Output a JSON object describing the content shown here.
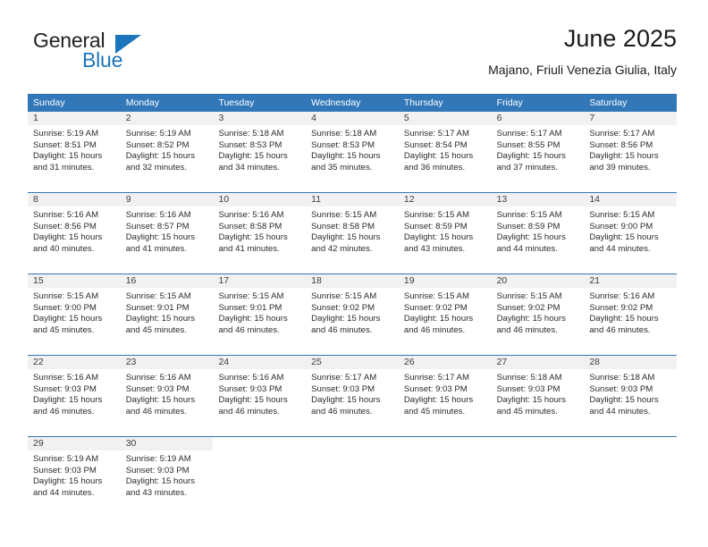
{
  "brand": {
    "name_part1": "General",
    "name_part2": "Blue",
    "accent_color": "#1b75bc"
  },
  "header": {
    "title": "June 2025",
    "location": "Majano, Friuli Venezia Giulia, Italy"
  },
  "theme": {
    "header_blue": "#3277b8",
    "daynum_band": "#f1f1f1"
  },
  "weekdays": [
    "Sunday",
    "Monday",
    "Tuesday",
    "Wednesday",
    "Thursday",
    "Friday",
    "Saturday"
  ],
  "weeks": [
    [
      {
        "day": "1",
        "sunrise": "Sunrise: 5:19 AM",
        "sunset": "Sunset: 8:51 PM",
        "daylight1": "Daylight: 15 hours",
        "daylight2": "and 31 minutes."
      },
      {
        "day": "2",
        "sunrise": "Sunrise: 5:19 AM",
        "sunset": "Sunset: 8:52 PM",
        "daylight1": "Daylight: 15 hours",
        "daylight2": "and 32 minutes."
      },
      {
        "day": "3",
        "sunrise": "Sunrise: 5:18 AM",
        "sunset": "Sunset: 8:53 PM",
        "daylight1": "Daylight: 15 hours",
        "daylight2": "and 34 minutes."
      },
      {
        "day": "4",
        "sunrise": "Sunrise: 5:18 AM",
        "sunset": "Sunset: 8:53 PM",
        "daylight1": "Daylight: 15 hours",
        "daylight2": "and 35 minutes."
      },
      {
        "day": "5",
        "sunrise": "Sunrise: 5:17 AM",
        "sunset": "Sunset: 8:54 PM",
        "daylight1": "Daylight: 15 hours",
        "daylight2": "and 36 minutes."
      },
      {
        "day": "6",
        "sunrise": "Sunrise: 5:17 AM",
        "sunset": "Sunset: 8:55 PM",
        "daylight1": "Daylight: 15 hours",
        "daylight2": "and 37 minutes."
      },
      {
        "day": "7",
        "sunrise": "Sunrise: 5:17 AM",
        "sunset": "Sunset: 8:56 PM",
        "daylight1": "Daylight: 15 hours",
        "daylight2": "and 39 minutes."
      }
    ],
    [
      {
        "day": "8",
        "sunrise": "Sunrise: 5:16 AM",
        "sunset": "Sunset: 8:56 PM",
        "daylight1": "Daylight: 15 hours",
        "daylight2": "and 40 minutes."
      },
      {
        "day": "9",
        "sunrise": "Sunrise: 5:16 AM",
        "sunset": "Sunset: 8:57 PM",
        "daylight1": "Daylight: 15 hours",
        "daylight2": "and 41 minutes."
      },
      {
        "day": "10",
        "sunrise": "Sunrise: 5:16 AM",
        "sunset": "Sunset: 8:58 PM",
        "daylight1": "Daylight: 15 hours",
        "daylight2": "and 41 minutes."
      },
      {
        "day": "11",
        "sunrise": "Sunrise: 5:15 AM",
        "sunset": "Sunset: 8:58 PM",
        "daylight1": "Daylight: 15 hours",
        "daylight2": "and 42 minutes."
      },
      {
        "day": "12",
        "sunrise": "Sunrise: 5:15 AM",
        "sunset": "Sunset: 8:59 PM",
        "daylight1": "Daylight: 15 hours",
        "daylight2": "and 43 minutes."
      },
      {
        "day": "13",
        "sunrise": "Sunrise: 5:15 AM",
        "sunset": "Sunset: 8:59 PM",
        "daylight1": "Daylight: 15 hours",
        "daylight2": "and 44 minutes."
      },
      {
        "day": "14",
        "sunrise": "Sunrise: 5:15 AM",
        "sunset": "Sunset: 9:00 PM",
        "daylight1": "Daylight: 15 hours",
        "daylight2": "and 44 minutes."
      }
    ],
    [
      {
        "day": "15",
        "sunrise": "Sunrise: 5:15 AM",
        "sunset": "Sunset: 9:00 PM",
        "daylight1": "Daylight: 15 hours",
        "daylight2": "and 45 minutes."
      },
      {
        "day": "16",
        "sunrise": "Sunrise: 5:15 AM",
        "sunset": "Sunset: 9:01 PM",
        "daylight1": "Daylight: 15 hours",
        "daylight2": "and 45 minutes."
      },
      {
        "day": "17",
        "sunrise": "Sunrise: 5:15 AM",
        "sunset": "Sunset: 9:01 PM",
        "daylight1": "Daylight: 15 hours",
        "daylight2": "and 46 minutes."
      },
      {
        "day": "18",
        "sunrise": "Sunrise: 5:15 AM",
        "sunset": "Sunset: 9:02 PM",
        "daylight1": "Daylight: 15 hours",
        "daylight2": "and 46 minutes."
      },
      {
        "day": "19",
        "sunrise": "Sunrise: 5:15 AM",
        "sunset": "Sunset: 9:02 PM",
        "daylight1": "Daylight: 15 hours",
        "daylight2": "and 46 minutes."
      },
      {
        "day": "20",
        "sunrise": "Sunrise: 5:15 AM",
        "sunset": "Sunset: 9:02 PM",
        "daylight1": "Daylight: 15 hours",
        "daylight2": "and 46 minutes."
      },
      {
        "day": "21",
        "sunrise": "Sunrise: 5:16 AM",
        "sunset": "Sunset: 9:02 PM",
        "daylight1": "Daylight: 15 hours",
        "daylight2": "and 46 minutes."
      }
    ],
    [
      {
        "day": "22",
        "sunrise": "Sunrise: 5:16 AM",
        "sunset": "Sunset: 9:03 PM",
        "daylight1": "Daylight: 15 hours",
        "daylight2": "and 46 minutes."
      },
      {
        "day": "23",
        "sunrise": "Sunrise: 5:16 AM",
        "sunset": "Sunset: 9:03 PM",
        "daylight1": "Daylight: 15 hours",
        "daylight2": "and 46 minutes."
      },
      {
        "day": "24",
        "sunrise": "Sunrise: 5:16 AM",
        "sunset": "Sunset: 9:03 PM",
        "daylight1": "Daylight: 15 hours",
        "daylight2": "and 46 minutes."
      },
      {
        "day": "25",
        "sunrise": "Sunrise: 5:17 AM",
        "sunset": "Sunset: 9:03 PM",
        "daylight1": "Daylight: 15 hours",
        "daylight2": "and 46 minutes."
      },
      {
        "day": "26",
        "sunrise": "Sunrise: 5:17 AM",
        "sunset": "Sunset: 9:03 PM",
        "daylight1": "Daylight: 15 hours",
        "daylight2": "and 45 minutes."
      },
      {
        "day": "27",
        "sunrise": "Sunrise: 5:18 AM",
        "sunset": "Sunset: 9:03 PM",
        "daylight1": "Daylight: 15 hours",
        "daylight2": "and 45 minutes."
      },
      {
        "day": "28",
        "sunrise": "Sunrise: 5:18 AM",
        "sunset": "Sunset: 9:03 PM",
        "daylight1": "Daylight: 15 hours",
        "daylight2": "and 44 minutes."
      }
    ],
    [
      {
        "day": "29",
        "sunrise": "Sunrise: 5:19 AM",
        "sunset": "Sunset: 9:03 PM",
        "daylight1": "Daylight: 15 hours",
        "daylight2": "and 44 minutes."
      },
      {
        "day": "30",
        "sunrise": "Sunrise: 5:19 AM",
        "sunset": "Sunset: 9:03 PM",
        "daylight1": "Daylight: 15 hours",
        "daylight2": "and 43 minutes."
      },
      {
        "day": "",
        "sunrise": "",
        "sunset": "",
        "daylight1": "",
        "daylight2": ""
      },
      {
        "day": "",
        "sunrise": "",
        "sunset": "",
        "daylight1": "",
        "daylight2": ""
      },
      {
        "day": "",
        "sunrise": "",
        "sunset": "",
        "daylight1": "",
        "daylight2": ""
      },
      {
        "day": "",
        "sunrise": "",
        "sunset": "",
        "daylight1": "",
        "daylight2": ""
      },
      {
        "day": "",
        "sunrise": "",
        "sunset": "",
        "daylight1": "",
        "daylight2": ""
      }
    ]
  ]
}
